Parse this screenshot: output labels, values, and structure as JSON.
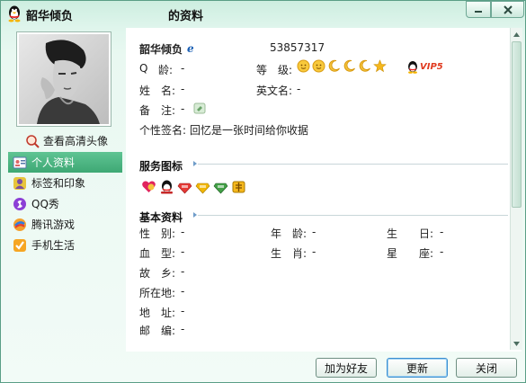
{
  "window": {
    "title_name": "韶华倾负",
    "title_suffix": "的资料",
    "controls": [
      "minimize",
      "close"
    ]
  },
  "left_panel": {
    "view_hd_avatar": "查看高清头像",
    "nav": [
      {
        "label": "个人资料",
        "icon": "contact-card-icon",
        "active": true
      },
      {
        "label": "标签和印象",
        "icon": "user-tag-icon",
        "active": false
      },
      {
        "label": "QQ秀",
        "icon": "qqshow-icon",
        "active": false
      },
      {
        "label": "腾讯游戏",
        "icon": "games-icon",
        "active": false
      },
      {
        "label": "手机生活",
        "icon": "mobile-life-icon",
        "active": false
      }
    ]
  },
  "profile": {
    "nickname": "韶华倾负",
    "qq_number": "53857317",
    "qq_label": "Q",
    "qq_age_label": "龄:",
    "qq_age": "-",
    "level_label": "等　级:",
    "level_icons": [
      "sun",
      "sun",
      "moon",
      "moon",
      "moon",
      "star"
    ],
    "vip_badge": "VIP5",
    "name_label": "姓　名:",
    "name_value": "-",
    "english_name_label": "英文名:",
    "english_name_value": "-",
    "remark_label": "备　注:",
    "remark_value": "-",
    "signature_label": "个性签名:",
    "signature_value": "回忆是一张时间给你收据"
  },
  "service_icons": {
    "title": "服务图标",
    "icons": [
      "love-icon",
      "qq-penguin-icon",
      "red-diamond-icon",
      "yellow-diamond-icon",
      "green-diamond-icon",
      "book-icon"
    ]
  },
  "basic_info": {
    "title": "基本资料",
    "rows": [
      [
        {
          "label": "性　别:",
          "value": "-"
        },
        {
          "label": "年　龄:",
          "value": "-"
        },
        {
          "label": "生　　日:",
          "value": "-"
        }
      ],
      [
        {
          "label": "血　型:",
          "value": "-"
        },
        {
          "label": "生　肖:",
          "value": "-"
        },
        {
          "label": "星　　座:",
          "value": "-"
        }
      ],
      [
        {
          "label": "故　乡:",
          "value": "-"
        }
      ],
      [
        {
          "label": "所在地:",
          "value": "-"
        }
      ],
      [
        {
          "label": "地　址:",
          "value": "-"
        }
      ],
      [
        {
          "label": "邮　编:",
          "value": "-"
        }
      ]
    ]
  },
  "buttons": {
    "add_friend": "加为好友",
    "update": "更新",
    "close": "关闭"
  },
  "colors": {
    "accent_green": "#3ea874",
    "window_bg": "#dff5ec",
    "rule_blue": "#6f9cc9"
  }
}
